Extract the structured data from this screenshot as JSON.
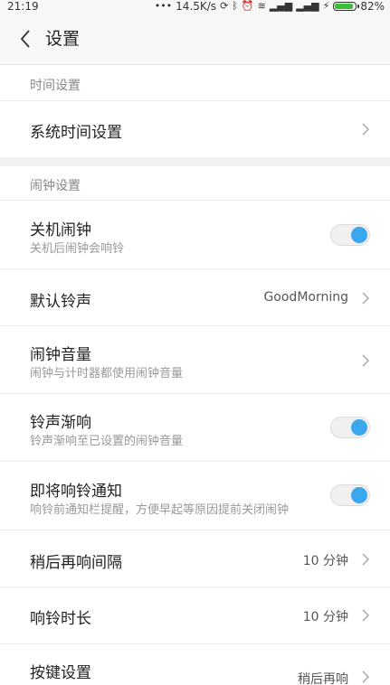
{
  "status_bar": {
    "time": "21:19",
    "net_speed": "14.5K/s",
    "battery": "82%",
    "battery_level": 0.82
  },
  "header": {
    "title": "设置"
  },
  "sections": [
    {
      "label": "时间设置",
      "rows": [
        {
          "title": "系统时间设置"
        }
      ]
    },
    {
      "label": "闹钟设置",
      "rows": [
        {
          "title": "关机闹钟",
          "subtitle": "关机后闹钟会响铃",
          "toggle_on": true
        },
        {
          "title": "默认铃声",
          "value": "GoodMorning"
        },
        {
          "title": "闹钟音量",
          "subtitle": "闹钟与计时器都使用闹钟音量"
        },
        {
          "title": "铃声渐响",
          "subtitle": "铃声渐响至已设置的闹钟音量",
          "toggle_on": true
        },
        {
          "title": "即将响铃通知",
          "subtitle": "响铃前通知栏提醒，方便早起等原因提前关闭闹钟",
          "toggle_on": true
        },
        {
          "title": "稍后再响间隔",
          "value": "10 分钟"
        },
        {
          "title": "响铃时长",
          "value": "10 分钟"
        },
        {
          "title": "按键设置",
          "value": "稍后再响"
        }
      ]
    }
  ],
  "colors": {
    "accent": "#3aa7ee",
    "battery": "#3cbf3a"
  }
}
